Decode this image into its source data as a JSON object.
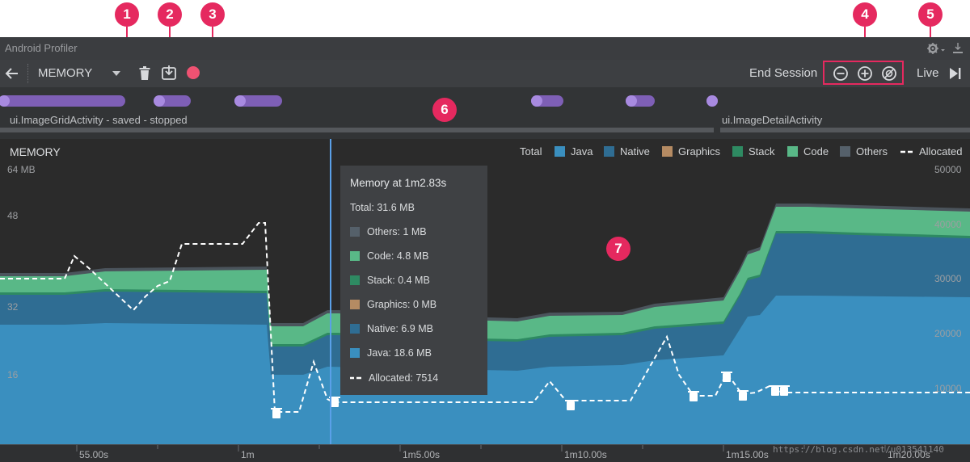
{
  "window": {
    "title": "Android Profiler"
  },
  "toolbar": {
    "profiler_label": "MEMORY",
    "end_session_label": "End Session",
    "live_label": "Live"
  },
  "callouts": [
    "1",
    "2",
    "3",
    "4",
    "5",
    "6",
    "7"
  ],
  "events": {
    "activities": [
      "ui.ImageGridActivity - saved - stopped",
      "ui.ImageDetailActivity"
    ]
  },
  "chart": {
    "title": "MEMORY",
    "left_axis": [
      "64 MB",
      "48",
      "32",
      "16"
    ],
    "right_axis": [
      "50000",
      "40000",
      "30000",
      "20000",
      "10000"
    ],
    "time_ticks": [
      "55.00s",
      "1m",
      "1m5.00s",
      "1m10.00s",
      "1m15.00s",
      "1m20.00s"
    ],
    "legend": {
      "total": "Total",
      "items": [
        "Java",
        "Native",
        "Graphics",
        "Stack",
        "Code",
        "Others",
        "Allocated"
      ]
    }
  },
  "colors": {
    "java": "#3a8fbf",
    "native": "#2f6d93",
    "graphics": "#b58b63",
    "stack": "#2e8a62",
    "code": "#59b887",
    "others": "#55606a",
    "accent": "#e5295f",
    "selection": "#5aa0e8"
  },
  "tooltip": {
    "title": "Memory at 1m2.83s",
    "total": "Total: 31.6 MB",
    "rows": [
      "Others: 1 MB",
      "Code: 4.8 MB",
      "Stack: 0.4 MB",
      "Graphics: 0 MB",
      "Native: 6.9 MB",
      "Java: 18.6 MB"
    ],
    "allocated": "Allocated: 7514"
  },
  "watermark": "https://blog.csdn.net/u013541140"
}
